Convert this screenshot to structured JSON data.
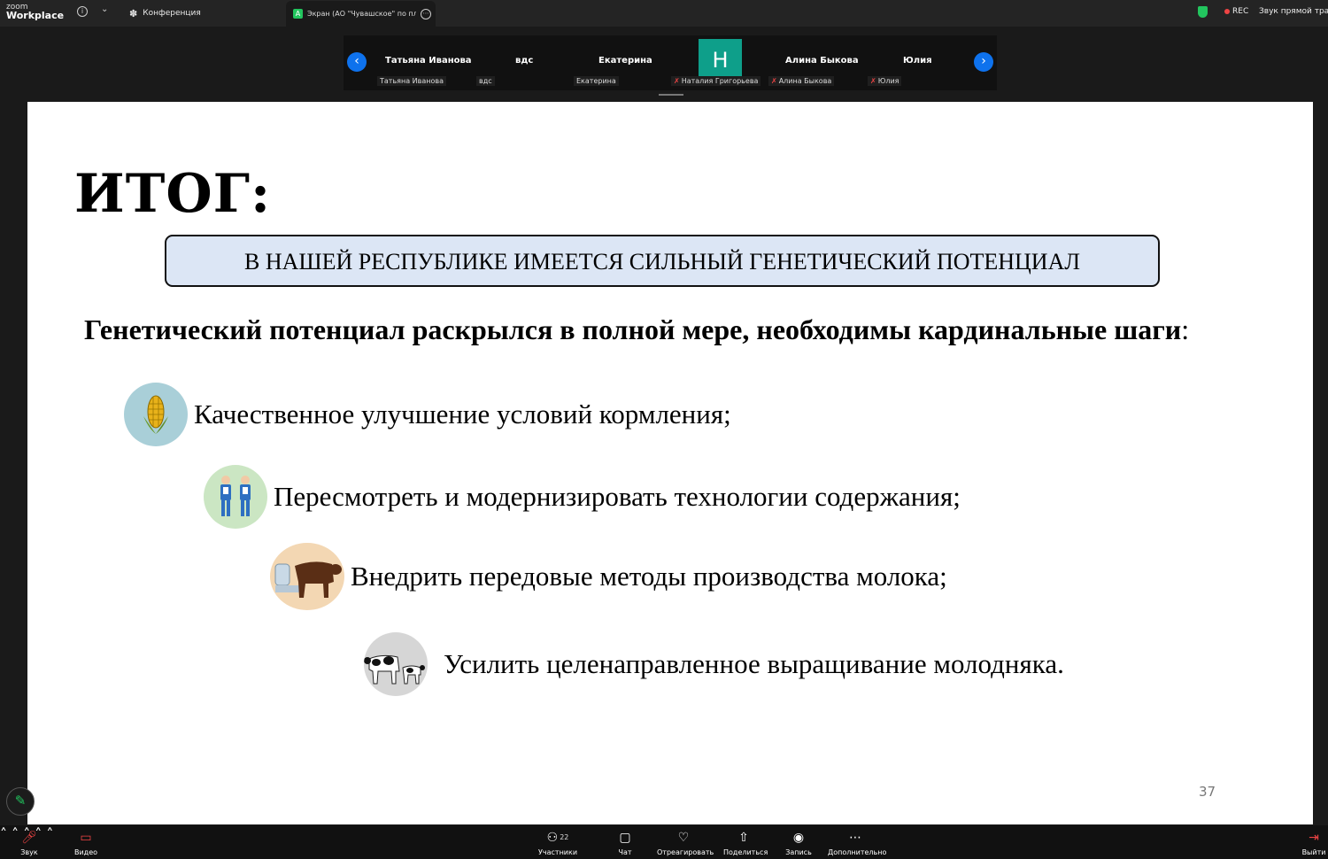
{
  "topbar": {
    "logo_small": "zoom",
    "logo_large": "Workplace",
    "tab_conference": "Конференция",
    "tab_screen": "Экран (АО \"Чувашское\" по пле",
    "rec_label": "REC",
    "live_label": "Звук прямой трансляции"
  },
  "participants": {
    "tiles": [
      {
        "name": "Татьяна Иванова",
        "tag": "Татьяна Иванова",
        "muted": false
      },
      {
        "name": "вдс",
        "tag": "вдс",
        "muted": false
      },
      {
        "name": "Екатерина",
        "tag": "Екатерина",
        "muted": false
      },
      {
        "name": "",
        "avatar_letter": "Н",
        "tag": "Наталия Григорьева",
        "muted": true
      },
      {
        "name": "Алина Быкова",
        "tag": "Алина Быкова",
        "muted": true
      },
      {
        "name": "Юлия",
        "tag": "Юлия",
        "muted": true
      }
    ]
  },
  "slide": {
    "title": "ИТОГ:",
    "banner": "В НАШЕЙ РЕСПУБЛИКЕ ИМЕЕТСЯ СИЛЬНЫЙ ГЕНЕТИЧЕСКИЙ ПОТЕНЦИАЛ",
    "subtitle": "Генетический потенциал раскрылся в полной мере, необходимы кардинальные шаги",
    "subtitle_colon": ":",
    "bullets": [
      {
        "text": "Качественное улучшение условий кормления;",
        "icon": "corn-icon"
      },
      {
        "text": "Пересмотреть и модернизировать технологии содержания;",
        "icon": "workers-icon"
      },
      {
        "text": "Внедрить передовые методы производства молока;",
        "icon": "cow-milking-icon"
      },
      {
        "text": "Усилить целенаправленное выращивание молодняка.",
        "icon": "cow-calf-icon"
      }
    ],
    "page_number": "37"
  },
  "toolbar": {
    "audio": "Звук",
    "video": "Видео",
    "participants": "Участники",
    "participants_count": "22",
    "chat": "Чат",
    "react": "Отреагировать",
    "share": "Поделиться",
    "record": "Запись",
    "more": "Дополнительно",
    "leave": "Выйти"
  },
  "colors": {
    "accent": "#0e72ed",
    "avatar": "#0e9f8a",
    "banner_bg": "#dce6f5",
    "mute": "#ef4444"
  }
}
